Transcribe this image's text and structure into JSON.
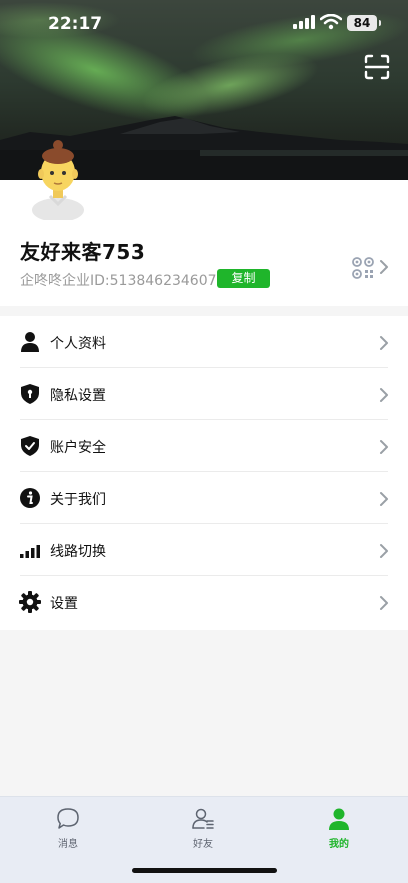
{
  "status_bar": {
    "time": "22:17",
    "battery": "84"
  },
  "profile": {
    "display_name": "友好来客753",
    "id_line": "企咚咚企业ID:513846234607",
    "copy_label": "复制"
  },
  "menu": {
    "items": [
      {
        "label": "个人资料",
        "icon": "person-icon"
      },
      {
        "label": "隐私设置",
        "icon": "shield-lock-icon"
      },
      {
        "label": "账户安全",
        "icon": "shield-check-icon"
      },
      {
        "label": "关于我们",
        "icon": "info-icon"
      },
      {
        "label": "线路切换",
        "icon": "signal-bars-icon"
      },
      {
        "label": "设置",
        "icon": "gear-icon"
      }
    ]
  },
  "tabbar": {
    "tabs": [
      {
        "label": "消息",
        "icon": "chat-bubble-icon",
        "active": false
      },
      {
        "label": "好友",
        "icon": "contacts-icon",
        "active": false
      },
      {
        "label": "我的",
        "icon": "person-icon",
        "active": true
      }
    ]
  },
  "colors": {
    "accent": "#1fb52b",
    "tabbar_bg": "#e8ecf4"
  }
}
